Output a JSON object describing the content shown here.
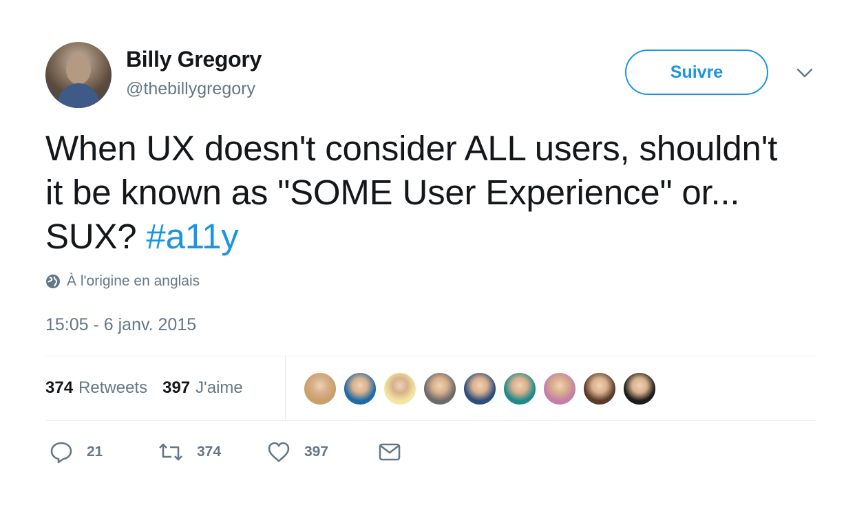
{
  "author": {
    "name": "Billy Gregory",
    "handle": "@thebillygregory"
  },
  "follow_label": "Suivre",
  "tweet": {
    "text": "When UX doesn't consider ALL users, shouldn't it be known as \"SOME User Experience\" or... SUX?",
    "hashtag": "#a11y",
    "original_language": "À l'origine en anglais",
    "timestamp": "15:05 - 6 janv. 2015"
  },
  "stats": {
    "retweets_count": "374",
    "retweets_label": "Retweets",
    "likes_count": "397",
    "likes_label": "J'aime"
  },
  "liker_avatars": [
    {
      "icon": "pixel-art-avatar",
      "bg": "#c8a06a"
    },
    {
      "icon": "glasses-bowtie-avatar",
      "bg": "#1f6aa5"
    },
    {
      "icon": "cartoon-face-avatar",
      "bg": "#f2e6a0"
    },
    {
      "icon": "photo-avatar",
      "bg": "#6b6b6b"
    },
    {
      "icon": "photo-avatar",
      "bg": "#2e4d7a"
    },
    {
      "icon": "photo-avatar",
      "bg": "#1f8a8a"
    },
    {
      "icon": "photo-avatar",
      "bg": "#c47fa8"
    },
    {
      "icon": "photo-avatar",
      "bg": "#5a3a28"
    },
    {
      "icon": "photo-avatar",
      "bg": "#1c1c1c"
    }
  ],
  "actions": {
    "replies": "21",
    "retweets": "374",
    "likes": "397"
  },
  "colors": {
    "accent": "#1b95e0",
    "secondary_text": "#657786",
    "primary_text": "#14171a"
  }
}
